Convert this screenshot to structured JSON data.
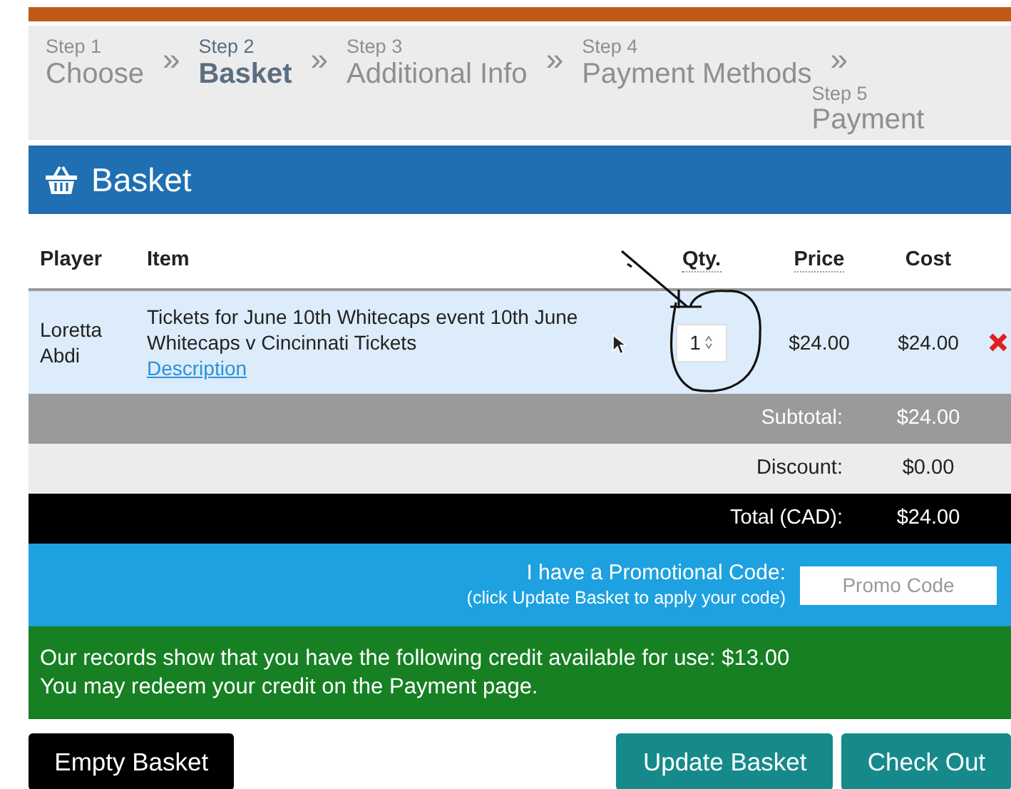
{
  "steps": [
    {
      "step": "Step 1",
      "label": "Choose",
      "selected": false
    },
    {
      "step": "Step 2",
      "label": "Basket",
      "selected": true
    },
    {
      "step": "Step 3",
      "label": "Additional Info",
      "selected": false
    },
    {
      "step": "Step 4",
      "label": "Payment Methods",
      "selected": false
    },
    {
      "step": "Step 5",
      "label": "Payment",
      "selected": false
    }
  ],
  "step_separator": "»",
  "header": {
    "title": "Basket"
  },
  "table": {
    "columns": [
      "Player",
      "Item",
      "Qty.",
      "Price",
      "Cost"
    ],
    "rows": [
      {
        "player": "Loretta Abdi",
        "item": "Tickets for June 10th Whitecaps event 10th June Whitecaps v Cincinnati Tickets",
        "link": "Description",
        "qty": "1",
        "price": "$24.00",
        "cost": "$24.00"
      }
    ]
  },
  "summary": [
    {
      "kind": "subtotal",
      "label": "Subtotal:",
      "value": "$24.00"
    },
    {
      "kind": "discount",
      "label": "Discount:",
      "value": "$0.00"
    },
    {
      "kind": "total",
      "label": "Total (CAD):",
      "value": "$24.00"
    }
  ],
  "promo": {
    "label": "I have a Promotional Code:",
    "hint": "(click Update Basket to apply your code)",
    "placeholder": "Promo Code"
  },
  "credit_notice": [
    "Our records show that you have the following credit available for use: $13.00",
    "You may redeem your credit on the Payment page."
  ],
  "buttons": [
    {
      "kind": "dark",
      "label": "Empty Basket"
    },
    {
      "kind": "teal",
      "label": "Update Basket"
    },
    {
      "kind": "teal",
      "label": "Check Out"
    }
  ]
}
